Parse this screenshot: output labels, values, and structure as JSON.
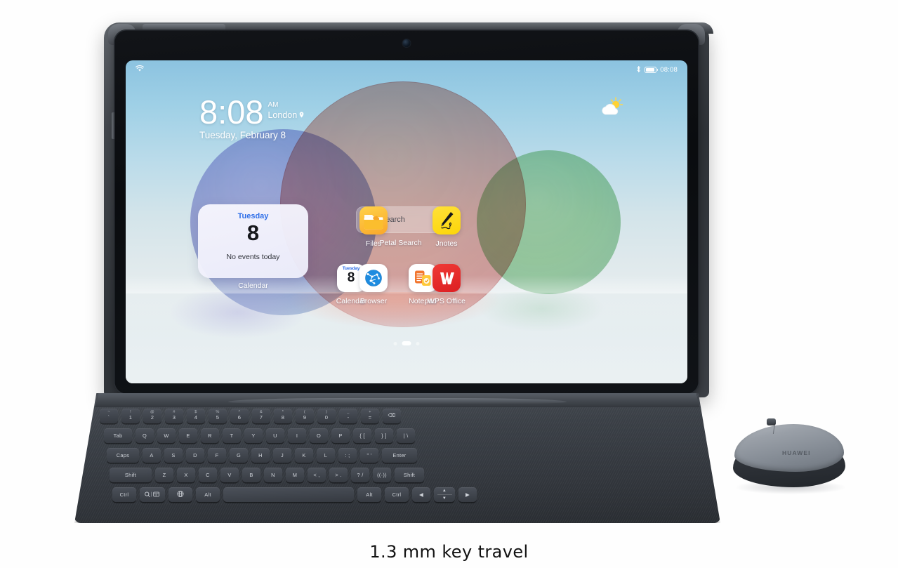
{
  "caption": "1.3 mm key travel",
  "device": {
    "brand": "HUAWEI",
    "mouse_brand": "HUAWEI"
  },
  "screen": {
    "statusbar": {
      "wifi_icon": "wifi-icon",
      "bluetooth_icon": "bluetooth-icon",
      "battery_icon": "battery-icon",
      "clock": "08:08"
    },
    "clock_widget": {
      "time": "8:08",
      "ampm": "AM",
      "city": "London",
      "location_icon": "location-pin-icon",
      "date": "Tuesday, February 8"
    },
    "weather_widget": {
      "icon": "partly-cloudy-icon"
    },
    "calendar_widget": {
      "weekday": "Tuesday",
      "day_number": "8",
      "events": "No events today",
      "label": "Calendar"
    },
    "search_widget": {
      "icon": "search-icon",
      "placeholder": "Search",
      "label": "Petal Search"
    },
    "apps": [
      {
        "name": "Files",
        "icon": "files-folder-icon"
      },
      {
        "name": "Jnotes",
        "icon": "jnotes-pen-icon"
      },
      {
        "name": "Calendar",
        "icon": "calendar-icon",
        "weekday": "Tuesday",
        "day_number": "8"
      },
      {
        "name": "Notepad",
        "icon": "notepad-icon"
      },
      {
        "name": "Browser",
        "icon": "browser-globe-icon"
      },
      {
        "name": "WPS Office",
        "icon": "wps-office-icon"
      }
    ],
    "page_dots": {
      "count": 3,
      "active_index": 1
    }
  },
  "keyboard": {
    "rows": {
      "number_row": [
        {
          "top": "~",
          "bottom": "`"
        },
        {
          "top": "!",
          "bottom": "1"
        },
        {
          "top": "@",
          "bottom": "2"
        },
        {
          "top": "#",
          "bottom": "3"
        },
        {
          "top": "$",
          "bottom": "4"
        },
        {
          "top": "%",
          "bottom": "5"
        },
        {
          "top": "^",
          "bottom": "6"
        },
        {
          "top": "&",
          "bottom": "7"
        },
        {
          "top": "*",
          "bottom": "8"
        },
        {
          "top": "(",
          "bottom": "9"
        },
        {
          "top": ")",
          "bottom": "0"
        },
        {
          "top": "_",
          "bottom": "-"
        },
        {
          "top": "+",
          "bottom": "="
        },
        {
          "top": "",
          "bottom": "⌫"
        }
      ],
      "qwerty_row": [
        "Tab",
        "Q",
        "W",
        "E",
        "R",
        "T",
        "Y",
        "U",
        "I",
        "O",
        "P",
        "{ [",
        "} ]",
        "| \\"
      ],
      "home_row": [
        "Caps",
        "A",
        "S",
        "D",
        "F",
        "G",
        "H",
        "J",
        "K",
        "L",
        ": ;",
        "\" '",
        "Enter"
      ],
      "shift_row": [
        "Shift",
        "Z",
        "X",
        "C",
        "V",
        "B",
        "N",
        "M",
        "< ,",
        "> .",
        "? /",
        "((·))",
        "Shift"
      ],
      "bottom_row": [
        "Ctrl",
        "search-keyboard-icon",
        "globe-icon",
        "Alt",
        "space",
        "Alt",
        "Ctrl",
        "◀",
        "arrows-updown",
        "▶"
      ]
    }
  },
  "colors": {
    "accent_blue": "#2f6fe8",
    "wps_red": "#e8262a",
    "files_yellow": "#f9a72a",
    "jnotes_yellow": "#fcd508",
    "browser_blue": "#1e8ce0",
    "notepad_orange": "#f2762e",
    "keyboard_body": "#3c4148",
    "tablet_body": "#2f3338"
  }
}
